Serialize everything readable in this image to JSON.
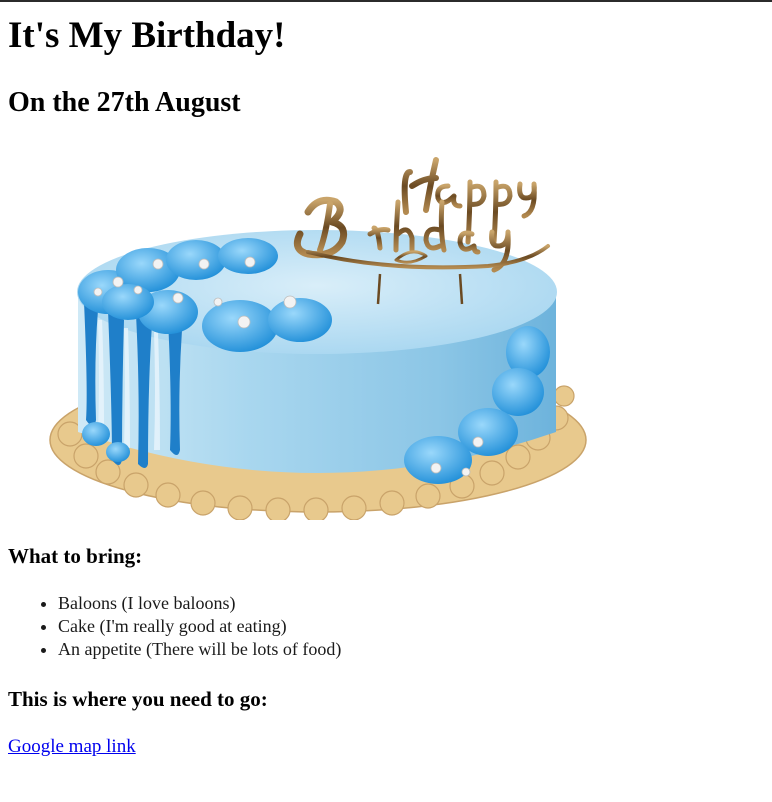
{
  "page": {
    "title": "It's My Birthday!",
    "subtitle": "On the 27th August"
  },
  "image": {
    "lettering": "Happy Birthday"
  },
  "bring": {
    "heading": "What to bring:",
    "items": [
      "Baloons (I love baloons)",
      "Cake (I'm really good at eating)",
      "An appetite (There will be lots of food)"
    ]
  },
  "directions": {
    "heading": "This is where you need to go:",
    "link_text": "Google map link"
  },
  "colors": {
    "link": "#0000ee",
    "frosting": "#8ccbea",
    "accent_blue": "#2b8fd6",
    "board": "#e9c98c",
    "topper_gold": "#8a6a3a"
  }
}
